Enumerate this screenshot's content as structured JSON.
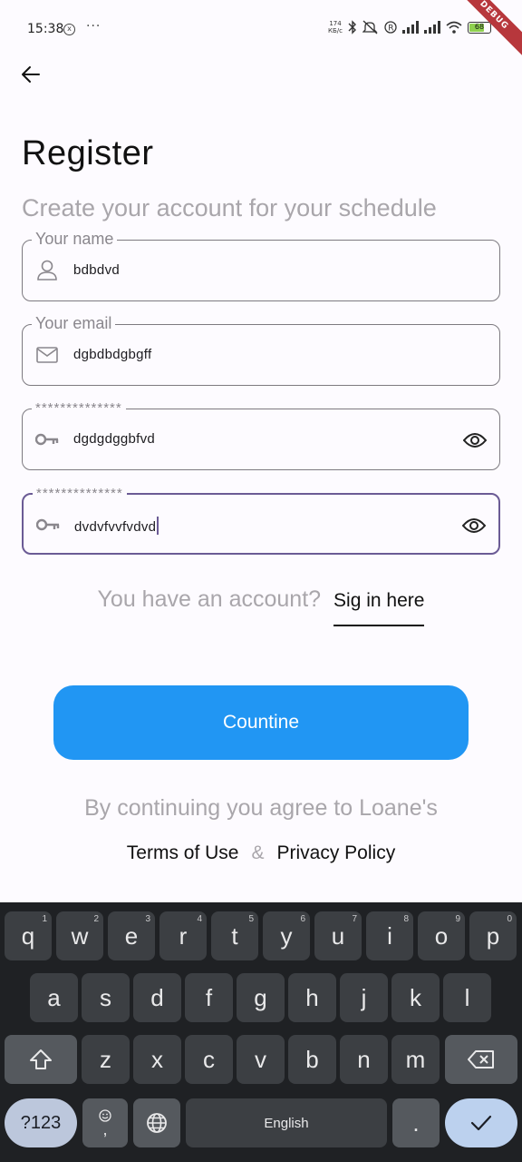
{
  "status_bar": {
    "time": "15:38",
    "notif_icon_letter": "x",
    "more": "···",
    "net_speed_value": "174",
    "net_speed_unit": "КБ/с",
    "battery_level": "68"
  },
  "debug_banner": "DEBUG",
  "header": {
    "title": "Register",
    "subtitle": "Create your account for your schedule"
  },
  "form": {
    "name": {
      "label": "Your name",
      "value": "bdbdvd",
      "icon": "person-icon"
    },
    "email": {
      "label": "Your email",
      "value": "dgbdbdgbgff",
      "icon": "mail-icon"
    },
    "password": {
      "label": "**************",
      "value": "dgdgdggbfvd",
      "icon": "key-icon"
    },
    "confirm_password": {
      "label": "**************",
      "value": "dvdvfvvfvdvd",
      "icon": "key-icon"
    }
  },
  "signin": {
    "prompt": "You have an account?",
    "link": "Sig in here"
  },
  "continue_label": "Countine",
  "legal": {
    "agree": "By continuing you agree to Loane's",
    "terms": "Terms of Use",
    "amp": "&",
    "privacy": "Privacy Policy"
  },
  "keyboard": {
    "row1": [
      {
        "k": "q",
        "h": "1"
      },
      {
        "k": "w",
        "h": "2"
      },
      {
        "k": "e",
        "h": "3"
      },
      {
        "k": "r",
        "h": "4"
      },
      {
        "k": "t",
        "h": "5"
      },
      {
        "k": "y",
        "h": "6"
      },
      {
        "k": "u",
        "h": "7"
      },
      {
        "k": "i",
        "h": "8"
      },
      {
        "k": "o",
        "h": "9"
      },
      {
        "k": "p",
        "h": "0"
      }
    ],
    "row2": [
      "a",
      "s",
      "d",
      "f",
      "g",
      "h",
      "j",
      "k",
      "l"
    ],
    "row3": [
      "z",
      "x",
      "c",
      "v",
      "b",
      "n",
      "m"
    ],
    "symbols": "?123",
    "comma": ",",
    "space": "English",
    "period": "."
  },
  "colors": {
    "accent": "#2196f3",
    "focus_border": "#6b5b95",
    "muted_text": "#a9a6ab"
  }
}
